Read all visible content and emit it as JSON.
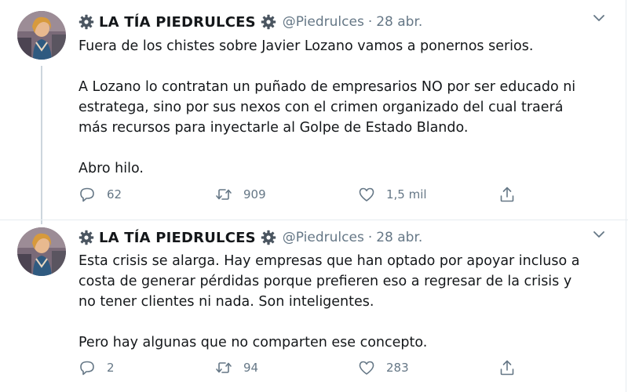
{
  "tweets": [
    {
      "display_name": "LA TÍA PIEDRULCES",
      "handle": "@Piedrulces",
      "separator": "·",
      "date": "28 abr.",
      "paragraphs": [
        "Fuera de los chistes sobre Javier Lozano vamos a ponernos serios.",
        "A Lozano lo contratan un puñado de empresarios NO por ser educado ni estratega, sino por sus nexos con el crimen organizado del cual traerá más recursos para inyectarle al Golpe de Estado Blando.",
        "Abro hilo."
      ],
      "replies": "62",
      "retweets": "909",
      "likes": "1,5 mil"
    },
    {
      "display_name": "LA TÍA PIEDRULCES",
      "handle": "@Piedrulces",
      "separator": "·",
      "date": "28 abr.",
      "paragraphs": [
        "Esta crisis se alarga. Hay empresas que han optado por apoyar incluso a costa de generar pérdidas porque prefieren eso a regresar de la crisis y no tener clientes ni nada. Son inteligentes.",
        "Pero hay algunas que no comparten ese concepto."
      ],
      "replies": "2",
      "retweets": "94",
      "likes": "283"
    }
  ],
  "icons": {
    "gear": "gear-icon",
    "chevron": "chevron-down-icon",
    "reply": "reply-icon",
    "retweet": "retweet-icon",
    "like": "heart-icon",
    "share": "share-icon"
  },
  "colors": {
    "text": "#14171a",
    "muted": "#657786",
    "thread_line": "#ccd6dd",
    "divider": "#e6ecf0"
  }
}
